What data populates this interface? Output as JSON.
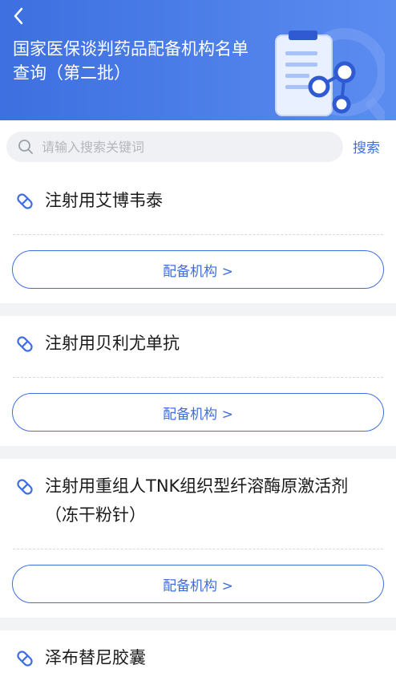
{
  "header": {
    "title": "国家医保谈判药品配备机构名单查询（第二批）"
  },
  "search": {
    "placeholder": "请输入搜索关键词",
    "button_label": "搜索"
  },
  "drugs": [
    {
      "name": "注射用艾博韦泰",
      "button_label": "配备机构 >"
    },
    {
      "name": "注射用贝利尤单抗",
      "button_label": "配备机构 >"
    },
    {
      "name": "注射用重组人TNK组织型纤溶酶原激活剂（冻干粉针）",
      "button_label": "配备机构 >"
    },
    {
      "name": "泽布替尼胶囊"
    }
  ],
  "colors": {
    "accent": "#3d6fe0",
    "header_gradient_start": "#3d6fe0",
    "header_gradient_end": "#5b8cf0"
  },
  "icons": {
    "back": "chevron-left-icon",
    "search": "search-icon",
    "drug": "pill-icon"
  }
}
